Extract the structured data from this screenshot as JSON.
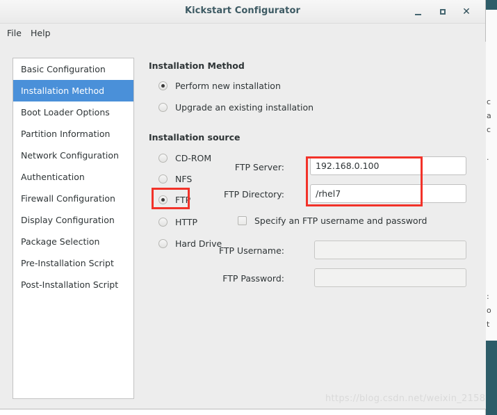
{
  "window": {
    "title": "Kickstart Configurator",
    "controls": {
      "minimize": "–",
      "maximize": "□",
      "close": "✕"
    }
  },
  "menubar": {
    "items": [
      {
        "label": "File"
      },
      {
        "label": "Help"
      }
    ]
  },
  "sidebar": {
    "items": [
      {
        "label": "Basic Configuration",
        "selected": false
      },
      {
        "label": "Installation Method",
        "selected": true
      },
      {
        "label": "Boot Loader Options",
        "selected": false
      },
      {
        "label": "Partition Information",
        "selected": false
      },
      {
        "label": "Network Configuration",
        "selected": false
      },
      {
        "label": "Authentication",
        "selected": false
      },
      {
        "label": "Firewall Configuration",
        "selected": false
      },
      {
        "label": "Display Configuration",
        "selected": false
      },
      {
        "label": "Package Selection",
        "selected": false
      },
      {
        "label": "Pre-Installation Script",
        "selected": false
      },
      {
        "label": "Post-Installation Script",
        "selected": false
      }
    ],
    "selected_index": 1,
    "selected_color": "#4a90d9"
  },
  "main": {
    "installation_method": {
      "heading": "Installation Method",
      "options": [
        {
          "label": "Perform new installation",
          "selected": true
        },
        {
          "label": "Upgrade an existing installation",
          "selected": false
        }
      ]
    },
    "installation_source": {
      "heading": "Installation source",
      "options": [
        {
          "label": "CD-ROM",
          "selected": false
        },
        {
          "label": "NFS",
          "selected": false
        },
        {
          "label": "FTP",
          "selected": true
        },
        {
          "label": "HTTP",
          "selected": false
        },
        {
          "label": "Hard Drive",
          "selected": false
        }
      ],
      "fields": {
        "server_label": "FTP Server:",
        "server_value": "192.168.0.100",
        "directory_label": "FTP Directory:",
        "directory_value": "/rhel7",
        "specify_credentials_label": "Specify an FTP username and password",
        "specify_credentials_checked": false,
        "username_label": "FTP Username:",
        "username_value": "",
        "password_label": "FTP Password:",
        "password_value": ""
      }
    }
  },
  "annotations": {
    "color": "#f23229",
    "boxes": [
      {
        "target": "ftp-radio-option"
      },
      {
        "target": "ftp-server-and-directory-values"
      }
    ]
  },
  "watermark": {
    "text": "https://blog.csdn.net/weixin_2158"
  },
  "background_window": {
    "title_color": "#2d5c68",
    "text_fragments": [
      "c",
      "a",
      "c",
      ".",
      ":",
      "o",
      "t"
    ]
  }
}
